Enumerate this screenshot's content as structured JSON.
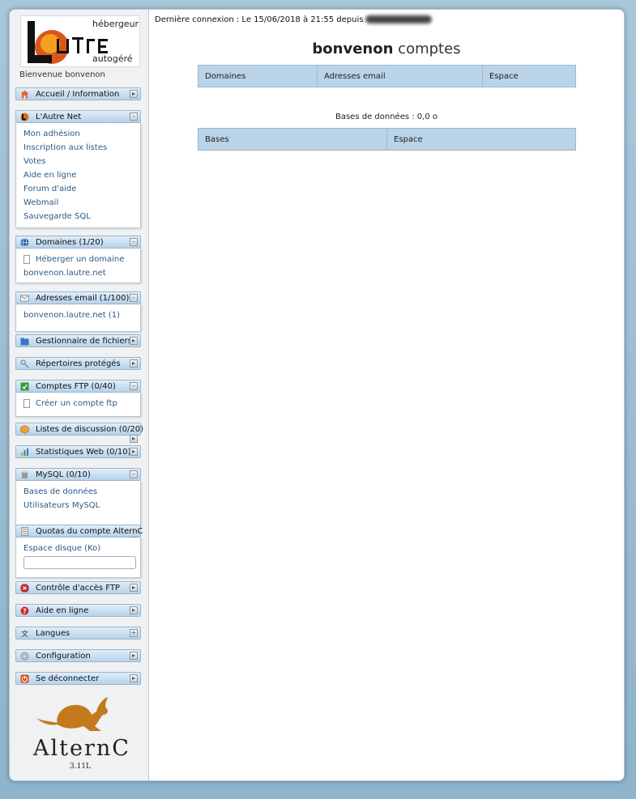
{
  "sidebar": {
    "logo_lines": [
      "hébergeur",
      "L'Autre",
      "autogéré"
    ],
    "welcome": "Bienvenue bonvenon",
    "menus": {
      "accueil": {
        "label": "Accueil / Information"
      },
      "autrenet": {
        "label": "L'Autre Net",
        "items": [
          "Mon adhésion",
          "Inscription aux listes",
          "Votes",
          "Aide en ligne",
          "Forum d'aide",
          "Webmail",
          "Sauvegarde SQL"
        ]
      },
      "domaines": {
        "label": "Domaines (1/20)",
        "items": [
          "Héberger un domaine",
          "bonvenon.lautre.net"
        ]
      },
      "email": {
        "label": "Adresses email (1/100)",
        "items": [
          "bonvenon.lautre.net (1)"
        ]
      },
      "fichiers": {
        "label": "Gestionnaire de fichiers"
      },
      "reps": {
        "label": "Répertoires protégés"
      },
      "ftp": {
        "label": "Comptes FTP (0/40)",
        "items": [
          "Créer un compte ftp"
        ]
      },
      "listes": {
        "label": "Listes de discussion (0/20)"
      },
      "stats": {
        "label": "Statistiques Web (0/10)"
      },
      "mysql": {
        "label": "MySQL (0/10)",
        "items": [
          "Bases de données",
          "Utilisateurs MySQL"
        ]
      },
      "quotas": {
        "label": "Quotas du compte AlternC",
        "items": [
          "Espace disque (Ko)"
        ]
      },
      "ctrlftp": {
        "label": "Contrôle d'accès FTP"
      },
      "aide": {
        "label": "Aide en ligne"
      },
      "langues": {
        "label": "Langues"
      },
      "config": {
        "label": "Configuration"
      },
      "logout": {
        "label": "Se déconnecter"
      }
    },
    "alternc_logo": "AlternC",
    "version": "3.11L"
  },
  "content": {
    "last_login": "Dernière connexion : Le 15/06/2018 à 21:55 depuis",
    "title_bold": "bonvenon",
    "title_rest": "comptes",
    "table1_headers": [
      "Domaines",
      "Adresses email",
      "Espace"
    ],
    "db_summary": "Bases de données : 0,0 o",
    "table2_headers": [
      "Bases",
      "Espace"
    ]
  },
  "colors": {
    "header_blue": "#b9d3e8",
    "link_blue": "#2a5a86",
    "background": "#a9c7db"
  }
}
